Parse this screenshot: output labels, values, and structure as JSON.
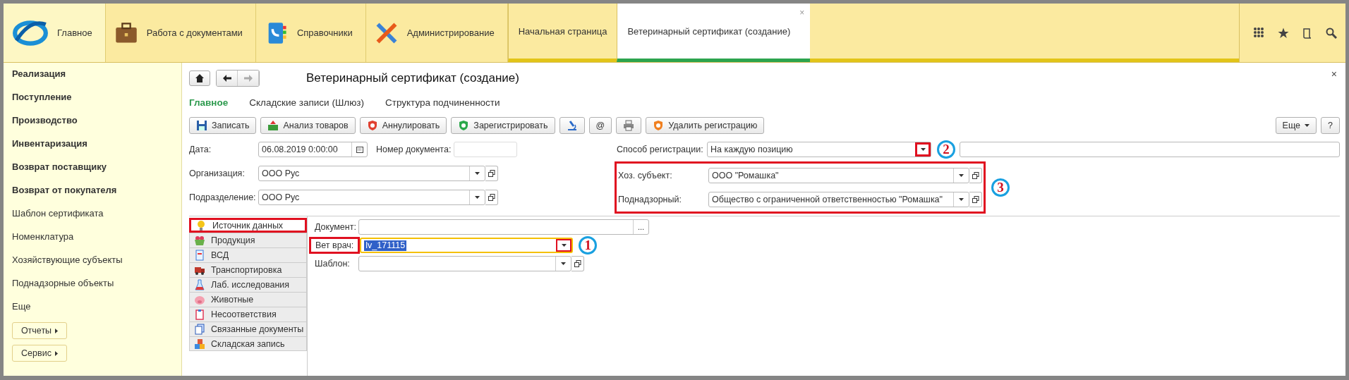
{
  "sections": [
    {
      "label": "Главное",
      "selected": true
    },
    {
      "label": "Работа с документами",
      "selected": false
    },
    {
      "label": "Справочники",
      "selected": false
    },
    {
      "label": "Администрирование",
      "selected": false
    }
  ],
  "open_tabs": [
    {
      "label": "Начальная страница",
      "selected": false
    },
    {
      "label": "Ветеринарный сертификат (создание)",
      "selected": true,
      "close": "×"
    }
  ],
  "sidebar": {
    "items": [
      {
        "label": "Реализация",
        "bold": true
      },
      {
        "label": "Поступление",
        "bold": true
      },
      {
        "label": "Производство",
        "bold": true
      },
      {
        "label": "Инвентаризация",
        "bold": true
      },
      {
        "label": "Возврат поставщику",
        "bold": true
      },
      {
        "label": "Возврат от покупателя",
        "bold": true
      },
      {
        "label": "Шаблон сертификата",
        "bold": false
      },
      {
        "label": "Номенклатура",
        "bold": false
      },
      {
        "label": "Хозяйствующие субъекты",
        "bold": false
      },
      {
        "label": "Поднадзорные объекты",
        "bold": false
      },
      {
        "label": "Еще",
        "bold": false
      }
    ],
    "buttons": [
      "Отчеты",
      "Сервис"
    ]
  },
  "form": {
    "title": "Ветеринарный сертификат (создание)",
    "close": "×",
    "tabs": [
      {
        "label": "Главное",
        "selected": true
      },
      {
        "label": "Складские записи (Шлюз)",
        "selected": false
      },
      {
        "label": "Структура подчиненности",
        "selected": false
      }
    ],
    "toolbar": [
      {
        "kind": "labeled",
        "label": "Записать"
      },
      {
        "kind": "labeled",
        "label": "Анализ товаров"
      },
      {
        "kind": "labeled",
        "label": "Аннулировать"
      },
      {
        "kind": "labeled",
        "label": "Зарегистрировать"
      },
      {
        "kind": "icon"
      },
      {
        "kind": "text",
        "label": "@"
      },
      {
        "kind": "icon"
      },
      {
        "kind": "labeled",
        "label": "Удалить регистрацию"
      }
    ],
    "more": "Еще",
    "help": "?",
    "date": {
      "label": "Дата:",
      "value": "06.08.2019  0:00:00"
    },
    "doc_number": {
      "label": "Номер документа:"
    },
    "left_fields": [
      {
        "label": "Организация:",
        "value": "ООО Рус"
      },
      {
        "label": "Подразделение:",
        "value": "ООО Рус"
      }
    ],
    "registration": {
      "label": "Способ регистрации:",
      "value": "На каждую позицию",
      "button_highlighted": true,
      "callout": "2"
    },
    "subject_group": {
      "highlighted": true,
      "callout": "3",
      "fields": [
        {
          "label": "Хоз. субъект:",
          "value": "ООО \"Ромашка\""
        },
        {
          "label": "Поднадзорный:",
          "value": "Общество с ограниченной ответственностью \"Ромашка\""
        }
      ]
    },
    "pages": [
      {
        "label": "Источник данных",
        "selected": true,
        "highlighted": true
      },
      {
        "label": "Продукция",
        "selected": false,
        "highlighted": false
      },
      {
        "label": "ВСД",
        "selected": false,
        "highlighted": false
      },
      {
        "label": "Транспортировка",
        "selected": false,
        "highlighted": false
      },
      {
        "label": "Лаб. исследования",
        "selected": false,
        "highlighted": false
      },
      {
        "label": "Животные",
        "selected": false,
        "highlighted": false
      },
      {
        "label": "Несоответствия",
        "selected": false,
        "highlighted": false
      },
      {
        "label": "Связанные документы",
        "selected": false,
        "highlighted": false
      },
      {
        "label": "Складская запись",
        "selected": false,
        "highlighted": false
      }
    ],
    "document": {
      "label": "Документ:",
      "button": "..."
    },
    "vet": {
      "label": "Вет врач:",
      "value": "lv_171115",
      "focused": true,
      "highlighted": true,
      "callout": "1"
    },
    "template": {
      "label": "Шаблон:"
    }
  }
}
